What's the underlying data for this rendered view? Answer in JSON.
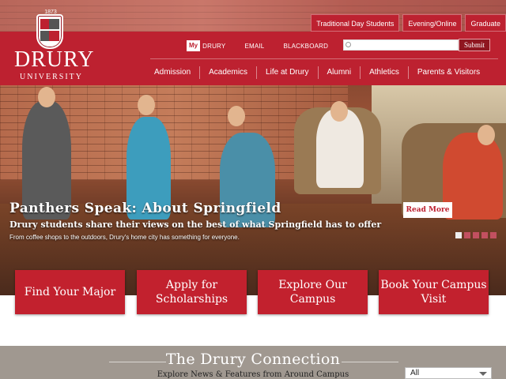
{
  "logo": {
    "year": "1873",
    "wordmark": "DRURY",
    "subtitle": "UNIVERSITY"
  },
  "audience_tabs": [
    "Traditional Day Students",
    "Evening/Online",
    "Graduate"
  ],
  "utility": {
    "my_badge": "My",
    "links": [
      "DRURY",
      "EMAIL",
      "BLACKBOARD"
    ],
    "search_placeholder": "",
    "submit_label": "Submit"
  },
  "nav": [
    "Admission",
    "Academics",
    "Life at Drury",
    "Alumni",
    "Athletics",
    "Parents & Visitors"
  ],
  "hero": {
    "title": "Panthers Speak: About Springfield",
    "subtitle": "Drury students share their views on the best of what Springfield has to offer",
    "small": "From coffee shops to the outdoors, Drury's home city has something for everyone.",
    "read_more": "Read More",
    "slide_count": 5,
    "active_slide": 1
  },
  "ctas": [
    {
      "label": "Find Your Major"
    },
    {
      "label": "Apply for Scholarships"
    },
    {
      "label": "Explore Our Campus"
    },
    {
      "label": "Book Your Campus Visit"
    }
  ],
  "connection": {
    "title": "The Drury Connection",
    "subtitle": "Explore News & Features from Around Campus",
    "filter_value": "All"
  },
  "colors": {
    "brand_red": "#bd2130",
    "cta_red": "#c2212e",
    "strip_gray": "#a09890"
  }
}
